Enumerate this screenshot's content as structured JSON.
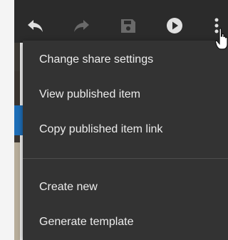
{
  "toolbar": {
    "icons": [
      "undo-icon",
      "redo-icon",
      "save-icon",
      "play-icon",
      "more-vertical-icon"
    ],
    "colors": {
      "background": "#2b2b2b",
      "active_icon": "#e0e0e0",
      "disabled_icon": "#6a6a6a"
    }
  },
  "menu": {
    "items": [
      {
        "label": "Change share settings"
      },
      {
        "label": "View published item"
      },
      {
        "label": "Copy published item link"
      },
      {
        "label": "Create new"
      },
      {
        "label": "Generate template"
      }
    ],
    "colors": {
      "background": "#333333",
      "text": "#ededed",
      "divider": "#4c4c4c"
    }
  }
}
